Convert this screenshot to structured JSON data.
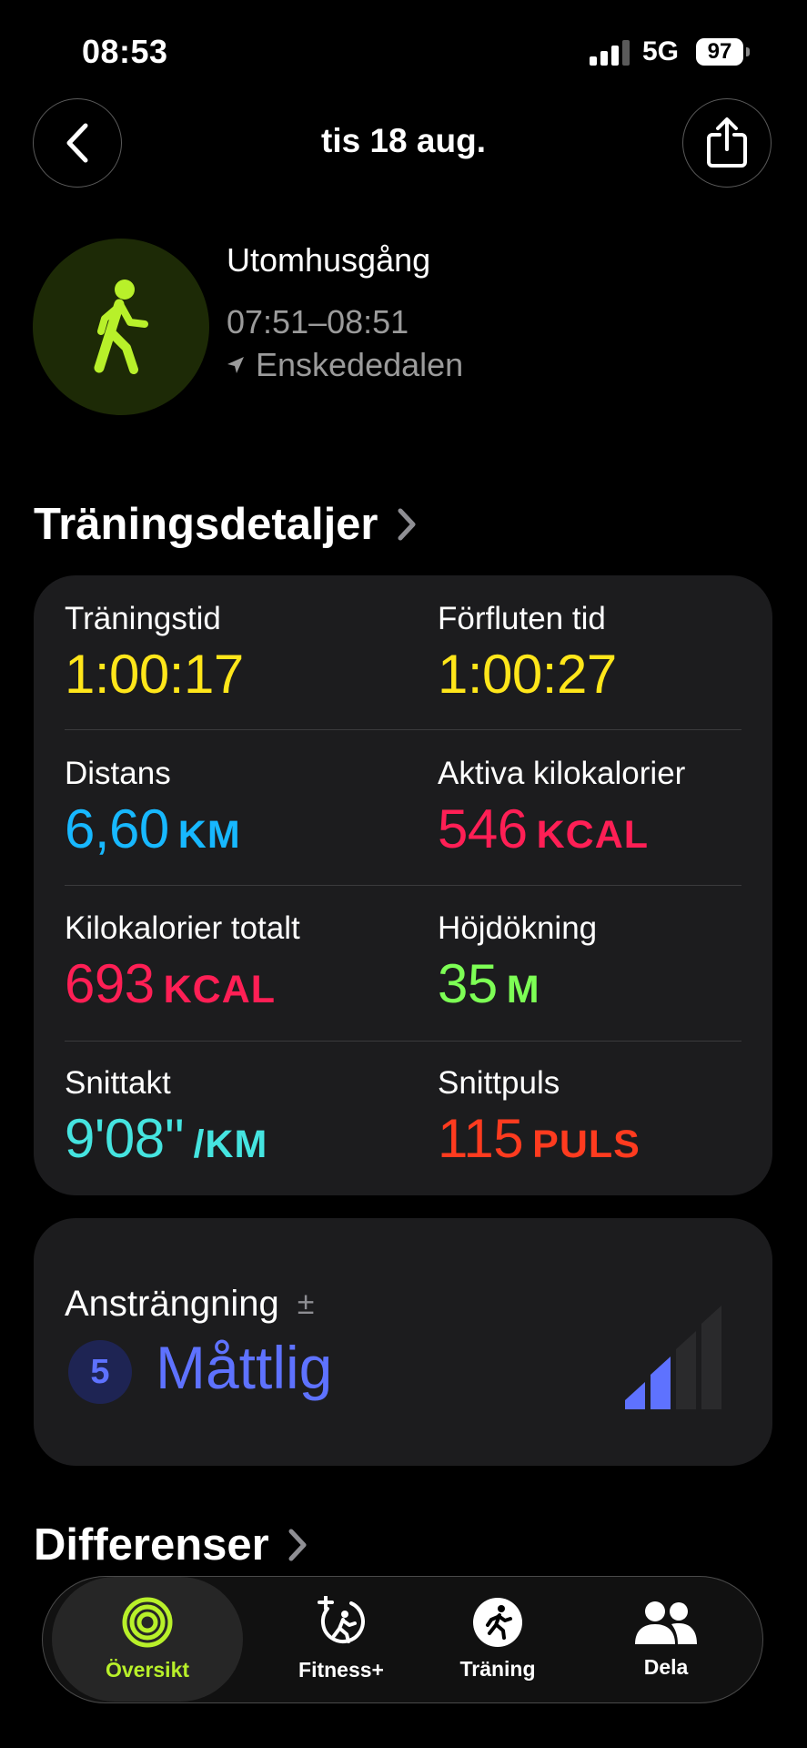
{
  "status_bar": {
    "time": "08:53",
    "network": "5G",
    "battery": "97"
  },
  "nav": {
    "title": "tis 18 aug."
  },
  "workout": {
    "type": "Utomhusgång",
    "time_range": "07:51–08:51",
    "location": "Enskededalen"
  },
  "sections": {
    "details_title": "Träningsdetaljer",
    "diff_title": "Differenser"
  },
  "metrics": [
    {
      "label": "Träningstid",
      "value": "1:00:17",
      "unit": "",
      "color": "#ffe61a"
    },
    {
      "label": "Förfluten tid",
      "value": "1:00:27",
      "unit": "",
      "color": "#ffe61a"
    },
    {
      "label": "Distans",
      "value": "6,60",
      "unit": "KM",
      "color": "#17b8ff"
    },
    {
      "label": "Aktiva kilokalorier",
      "value": "546",
      "unit": "KCAL",
      "color": "#ff1f55"
    },
    {
      "label": "Kilokalorier totalt",
      "value": "693",
      "unit": "KCAL",
      "color": "#ff1f55"
    },
    {
      "label": "Höjdökning",
      "value": "35",
      "unit": "M",
      "color": "#7dff55"
    },
    {
      "label": "Snittakt",
      "value": "9'08''",
      "unit": "/KM",
      "color": "#45e4e0"
    },
    {
      "label": "Snittpuls",
      "value": "115",
      "unit": "PULS",
      "color": "#ff3b1f"
    }
  ],
  "effort": {
    "label": "Ansträngning",
    "plusminus": "±",
    "score": "5",
    "value": "Måttlig",
    "level_fraction": 0.5,
    "color": "#5e72ff"
  },
  "tabs": [
    {
      "label": "Översikt",
      "icon": "activity-rings-icon",
      "active": true
    },
    {
      "label": "Fitness+",
      "icon": "fitness-plus-icon",
      "active": false
    },
    {
      "label": "Träning",
      "icon": "running-figure-icon",
      "active": false
    },
    {
      "label": "Dela",
      "icon": "people-icon",
      "active": false
    }
  ],
  "colors": {
    "activity_green": "#b8f02a",
    "background": "#000000",
    "card": "#1c1c1e"
  }
}
